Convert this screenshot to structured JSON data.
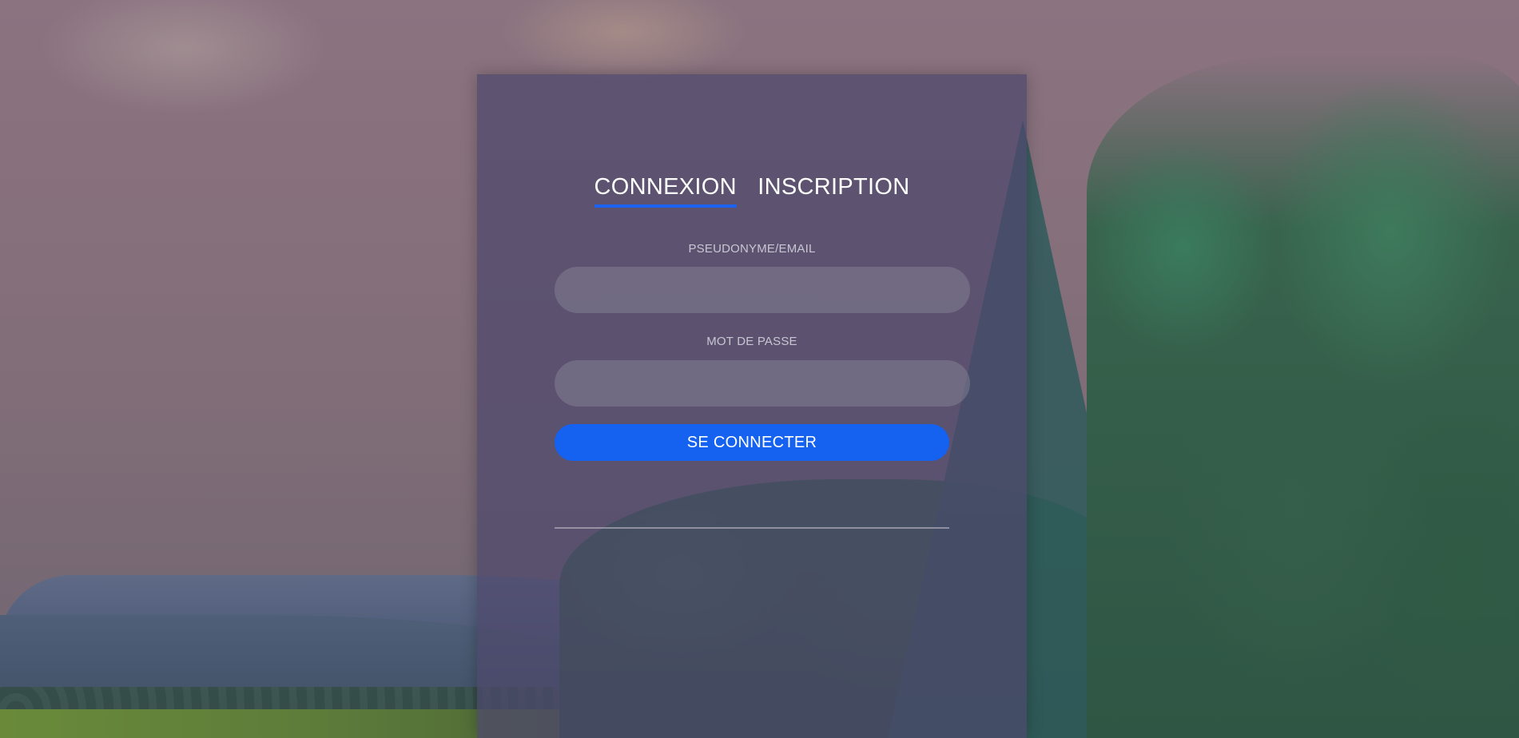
{
  "login": {
    "tabs": [
      {
        "label": "CONNEXION",
        "active": true
      },
      {
        "label": "INSCRIPTION",
        "active": false
      }
    ],
    "username_label": "PSEUDONYME/EMAIL",
    "username_value": "",
    "password_label": "MOT DE PASSE",
    "password_value": "",
    "submit_label": "SE CONNECTER"
  },
  "colors": {
    "accent": "#1561f0",
    "panel": "#4e486c"
  }
}
